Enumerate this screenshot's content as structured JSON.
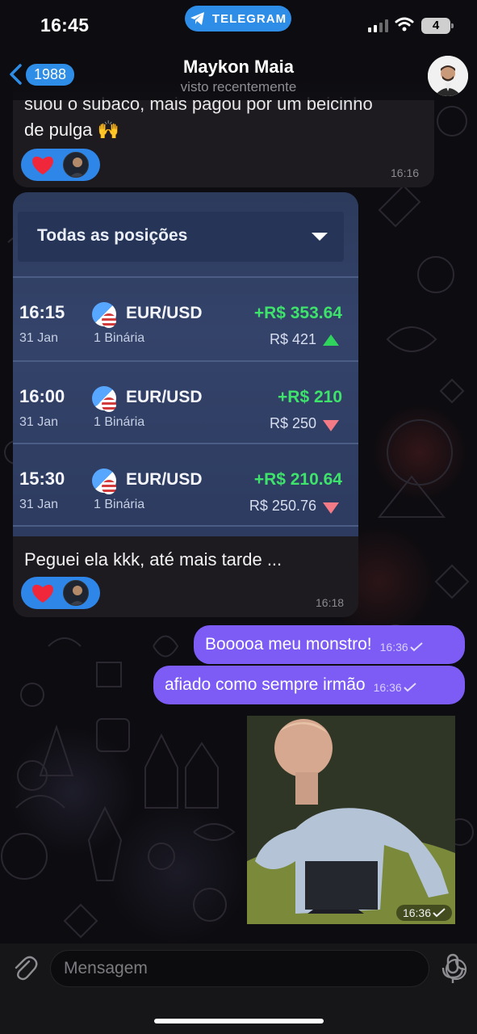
{
  "status_bar": {
    "time": "16:45",
    "pill_label": "TELEGRAM",
    "battery": "4"
  },
  "header": {
    "back_count": "1988",
    "title": "Maykon Maia",
    "subtitle": "visto recentemente"
  },
  "messages": [
    {
      "id": "m1",
      "direction": "incoming",
      "text_line1": "suou o subaco, mais pagou por um beicinho",
      "text_line2": "de pulga 🙌",
      "reaction": "❤️",
      "time": "16:16"
    },
    {
      "id": "m2",
      "direction": "incoming",
      "image": {
        "dropdown_label": "Todas as posições",
        "rows": [
          {
            "time": "16:15",
            "date": "31 Jan",
            "pair": "EUR/USD",
            "type": "1 Binária",
            "profit": "+R$ 353.64",
            "amount": "R$ 421",
            "trend": "up"
          },
          {
            "time": "16:00",
            "date": "31 Jan",
            "pair": "EUR/USD",
            "type": "1 Binária",
            "profit": "+R$ 210",
            "amount": "R$ 250",
            "trend": "down"
          },
          {
            "time": "15:30",
            "date": "31 Jan",
            "pair": "EUR/USD",
            "type": "1 Binária",
            "profit": "+R$ 210.64",
            "amount": "R$ 250.76",
            "trend": "down"
          }
        ]
      },
      "caption": "Peguei ela kkk, até mais tarde ...",
      "reaction": "❤️",
      "time": "16:18"
    },
    {
      "id": "m3",
      "direction": "outgoing",
      "text": "Booooa meu monstro!",
      "time": "16:36",
      "status": "read"
    },
    {
      "id": "m4",
      "direction": "outgoing",
      "text": "afiado como sempre irmão",
      "time": "16:36",
      "status": "read"
    },
    {
      "id": "m5",
      "direction": "outgoing",
      "type": "video",
      "time": "16:36",
      "status": "read"
    }
  ],
  "input": {
    "placeholder": "Mensagem"
  },
  "colors": {
    "accent": "#2e8de6",
    "outgoing_bubble": "#7c5cf5",
    "incoming_bubble": "#1d1b20",
    "reaction": "#2e86e8"
  },
  "icons": [
    "back-chevron-icon",
    "telegram-icon",
    "signal-icon",
    "wifi-icon",
    "heart-icon",
    "read-check-icon",
    "attach-icon",
    "sticker-icon",
    "mic-icon"
  ]
}
